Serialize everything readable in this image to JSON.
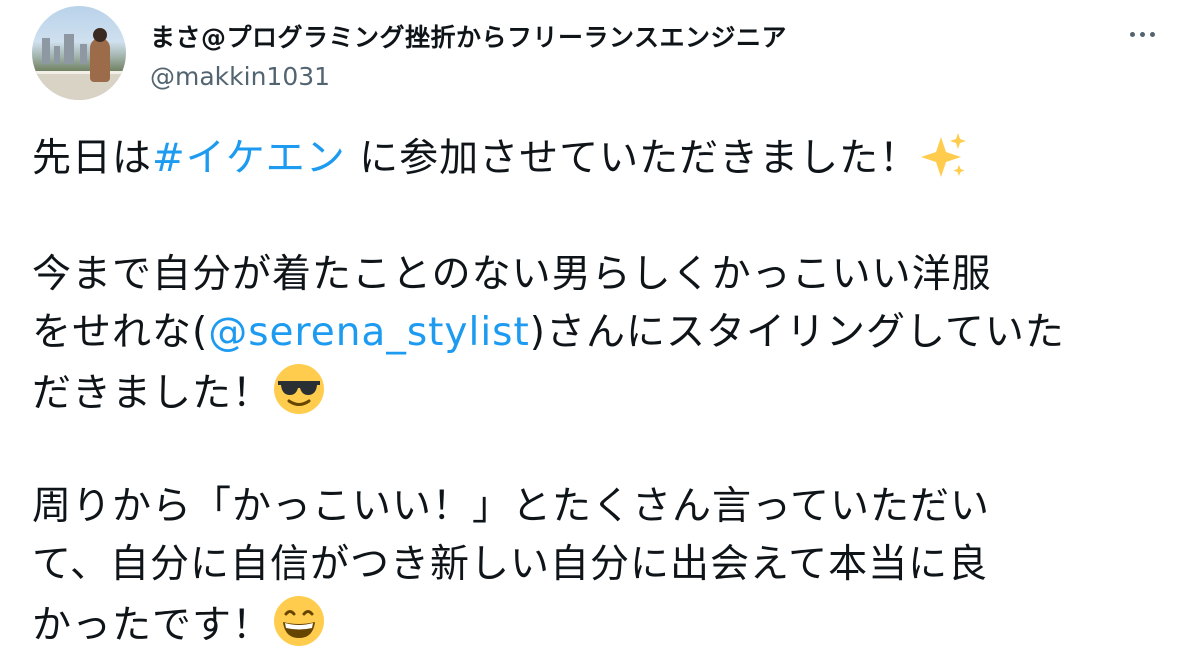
{
  "author": {
    "display_name": "まさ@プログラミング挫折からフリーランスエンジニア",
    "handle": "@makkin1031"
  },
  "more_icon": "ellipsis-horizontal-icon",
  "tweet": {
    "p1": {
      "a": "先日は",
      "hashtag": "#イケエン",
      "b": " に参加させていただきました！"
    },
    "p2_line1": "今まで自分が着たことのない男らしくかっこいい洋服",
    "p2_line2": {
      "a": "をせれな(",
      "mention": "@serena_stylist",
      "b": ")さんにスタイリングしていた"
    },
    "p2_line3": "だきました！",
    "p3_line1": "周りから「かっこいい！」とたくさん言っていただい",
    "p3_line2": "て、自分に自信がつき新しい自分に出会えて本当に良",
    "p3_line3": "かったです！"
  },
  "emojis": [
    "sparkles-icon",
    "sunglasses-face-icon",
    "grinning-face-icon"
  ],
  "colors": {
    "link": "#1d9bf0",
    "secondary_text": "#536471",
    "text": "#0f1419"
  }
}
